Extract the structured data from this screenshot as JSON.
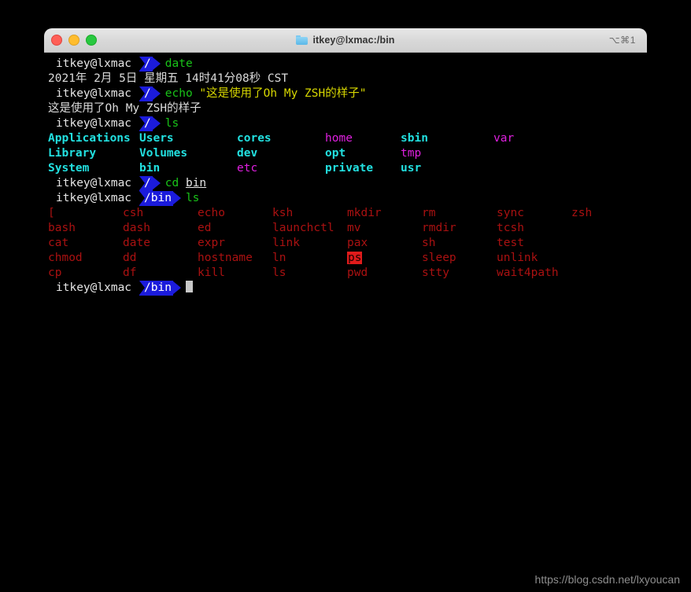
{
  "window": {
    "title": "itkey@lxmac:/bin",
    "shortcut": "⌥⌘1",
    "folder_icon": "folder-icon",
    "traffic_lights": {
      "close": "close-button",
      "minimize": "minimize-button",
      "maximize": "maximize-button"
    },
    "colors": {
      "background": "#000000",
      "titlebar": "#d8d8d8",
      "prompt_segment": "#1b1bdc",
      "command": "#19c419",
      "string": "#d7d700",
      "directory": "#22e0e0",
      "symlink": "#e020e0",
      "executable": "#aa1111",
      "setuid_background": "#e01b1b",
      "cursor": "#c8c8c8"
    }
  },
  "terminal": {
    "prompt_user": "itkey@lxmac",
    "prompt_path_root": "/",
    "prompt_path_bin": "/bin",
    "commands": {
      "date": "date",
      "echo": "echo",
      "echo_arg": "\"这是使用了Oh My ZSH的样子\"",
      "ls": "ls",
      "cd": "cd",
      "cd_arg": "bin"
    },
    "outputs": {
      "date_result": "2021年 2月 5日 星期五 14时41分08秒 CST",
      "echo_result": "这是使用了Oh My ZSH的样子"
    }
  },
  "ls_root": {
    "rows": [
      [
        {
          "name": "Applications",
          "type": "dir"
        },
        {
          "name": "Users",
          "type": "dir"
        },
        {
          "name": "cores",
          "type": "dir"
        },
        {
          "name": "home",
          "type": "link"
        },
        {
          "name": "sbin",
          "type": "dir"
        },
        {
          "name": "var",
          "type": "link"
        }
      ],
      [
        {
          "name": "Library",
          "type": "dir"
        },
        {
          "name": "Volumes",
          "type": "dir"
        },
        {
          "name": "dev",
          "type": "dir"
        },
        {
          "name": "opt",
          "type": "dir"
        },
        {
          "name": "tmp",
          "type": "link"
        },
        {
          "name": "",
          "type": "none"
        }
      ],
      [
        {
          "name": "System",
          "type": "dir"
        },
        {
          "name": "bin",
          "type": "dir"
        },
        {
          "name": "etc",
          "type": "link"
        },
        {
          "name": "private",
          "type": "dir"
        },
        {
          "name": "usr",
          "type": "dir"
        },
        {
          "name": "",
          "type": "none"
        }
      ]
    ]
  },
  "ls_bin": {
    "rows": [
      [
        {
          "name": "[",
          "type": "exec"
        },
        {
          "name": "csh",
          "type": "exec"
        },
        {
          "name": "echo",
          "type": "exec"
        },
        {
          "name": "ksh",
          "type": "exec"
        },
        {
          "name": "mkdir",
          "type": "exec"
        },
        {
          "name": "rm",
          "type": "exec"
        },
        {
          "name": "sync",
          "type": "exec"
        },
        {
          "name": "zsh",
          "type": "exec"
        }
      ],
      [
        {
          "name": "bash",
          "type": "exec"
        },
        {
          "name": "dash",
          "type": "exec"
        },
        {
          "name": "ed",
          "type": "exec"
        },
        {
          "name": "launchctl",
          "type": "exec"
        },
        {
          "name": "mv",
          "type": "exec"
        },
        {
          "name": "rmdir",
          "type": "exec"
        },
        {
          "name": "tcsh",
          "type": "exec"
        },
        {
          "name": "",
          "type": "none"
        }
      ],
      [
        {
          "name": "cat",
          "type": "exec"
        },
        {
          "name": "date",
          "type": "exec"
        },
        {
          "name": "expr",
          "type": "exec"
        },
        {
          "name": "link",
          "type": "exec"
        },
        {
          "name": "pax",
          "type": "exec"
        },
        {
          "name": "sh",
          "type": "exec"
        },
        {
          "name": "test",
          "type": "exec"
        },
        {
          "name": "",
          "type": "none"
        }
      ],
      [
        {
          "name": "chmod",
          "type": "exec"
        },
        {
          "name": "dd",
          "type": "exec"
        },
        {
          "name": "hostname",
          "type": "exec"
        },
        {
          "name": "ln",
          "type": "exec"
        },
        {
          "name": "ps",
          "type": "setuid"
        },
        {
          "name": "sleep",
          "type": "exec"
        },
        {
          "name": "unlink",
          "type": "exec"
        },
        {
          "name": "",
          "type": "none"
        }
      ],
      [
        {
          "name": "cp",
          "type": "exec"
        },
        {
          "name": "df",
          "type": "exec"
        },
        {
          "name": "kill",
          "type": "exec"
        },
        {
          "name": "ls",
          "type": "exec"
        },
        {
          "name": "pwd",
          "type": "exec"
        },
        {
          "name": "stty",
          "type": "exec"
        },
        {
          "name": "wait4path",
          "type": "exec"
        },
        {
          "name": "",
          "type": "none"
        }
      ]
    ]
  },
  "watermark": "https://blog.csdn.net/lxyoucan"
}
